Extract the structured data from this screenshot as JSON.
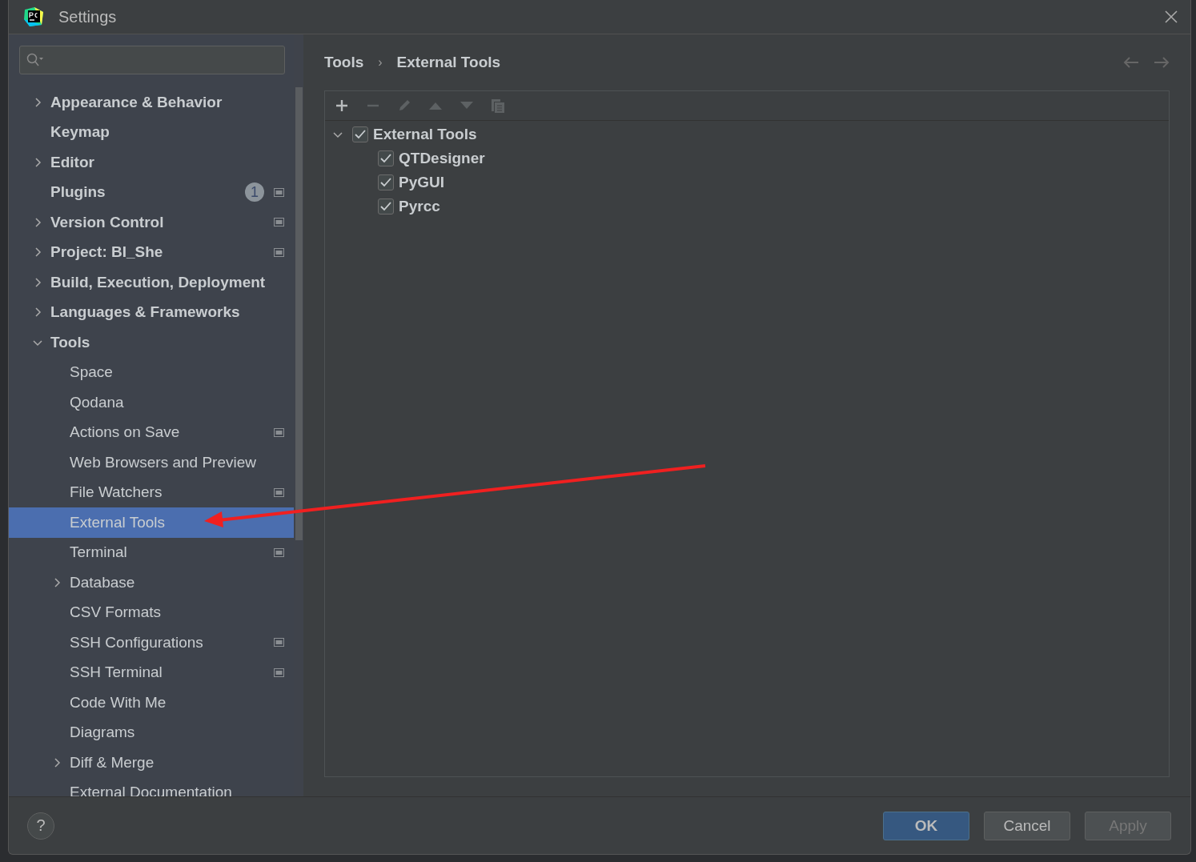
{
  "window": {
    "title": "Settings"
  },
  "sidebar": {
    "items": [
      {
        "label": "Appearance & Behavior",
        "kind": "folder",
        "expanded": false,
        "selected": false
      },
      {
        "label": "Keymap",
        "kind": "leaf",
        "selected": false
      },
      {
        "label": "Editor",
        "kind": "folder",
        "expanded": false,
        "selected": false
      },
      {
        "label": "Plugins",
        "kind": "leaf",
        "selected": false,
        "badge": "1",
        "project_level": true
      },
      {
        "label": "Version Control",
        "kind": "folder",
        "expanded": false,
        "selected": false,
        "project_level": true
      },
      {
        "label": "Project: BI_She",
        "kind": "folder",
        "expanded": false,
        "selected": false,
        "project_level": true
      },
      {
        "label": "Build, Execution, Deployment",
        "kind": "folder",
        "expanded": false,
        "selected": false
      },
      {
        "label": "Languages & Frameworks",
        "kind": "folder",
        "expanded": false,
        "selected": false
      },
      {
        "label": "Tools",
        "kind": "folder",
        "expanded": true,
        "selected": false,
        "children": [
          {
            "label": "Space",
            "kind": "leaf",
            "selected": false
          },
          {
            "label": "Qodana",
            "kind": "leaf",
            "selected": false
          },
          {
            "label": "Actions on Save",
            "kind": "leaf",
            "selected": false,
            "project_level": true
          },
          {
            "label": "Web Browsers and Preview",
            "kind": "leaf",
            "selected": false
          },
          {
            "label": "File Watchers",
            "kind": "leaf",
            "selected": false,
            "project_level": true
          },
          {
            "label": "External Tools",
            "kind": "leaf",
            "selected": true
          },
          {
            "label": "Terminal",
            "kind": "leaf",
            "selected": false,
            "project_level": true
          },
          {
            "label": "Database",
            "kind": "folder",
            "expanded": false,
            "selected": false
          },
          {
            "label": "CSV Formats",
            "kind": "leaf",
            "selected": false
          },
          {
            "label": "SSH Configurations",
            "kind": "leaf",
            "selected": false,
            "project_level": true
          },
          {
            "label": "SSH Terminal",
            "kind": "leaf",
            "selected": false,
            "project_level": true
          },
          {
            "label": "Code With Me",
            "kind": "leaf",
            "selected": false
          },
          {
            "label": "Diagrams",
            "kind": "leaf",
            "selected": false
          },
          {
            "label": "Diff & Merge",
            "kind": "folder",
            "expanded": false,
            "selected": false
          },
          {
            "label": "External Documentation",
            "kind": "leaf",
            "selected": false
          }
        ]
      }
    ]
  },
  "breadcrumb": [
    {
      "label": "Tools"
    },
    {
      "label": "›",
      "kind": "separator"
    },
    {
      "label": "External Tools"
    }
  ],
  "toolbar": [
    {
      "kind": "add",
      "disabled": false
    },
    {
      "kind": "remove",
      "disabled": true
    },
    {
      "kind": "edit",
      "disabled": true
    },
    {
      "kind": "up",
      "disabled": true
    },
    {
      "kind": "down",
      "disabled": true
    },
    {
      "kind": "copy",
      "disabled": true
    }
  ],
  "tree": [
    {
      "label": "External Tools",
      "checked": true,
      "expanded": true,
      "children": [
        {
          "label": "QTDesigner",
          "checked": true
        },
        {
          "label": "PyGUI",
          "checked": true
        },
        {
          "label": "Pyrcc",
          "checked": true
        }
      ]
    }
  ],
  "help": {
    "label": "?"
  },
  "buttons": [
    {
      "label": "OK",
      "kind": "primary",
      "disabled": false
    },
    {
      "label": "Cancel",
      "kind": "normal",
      "disabled": false
    },
    {
      "label": "Apply",
      "kind": "normal",
      "disabled": true
    }
  ]
}
